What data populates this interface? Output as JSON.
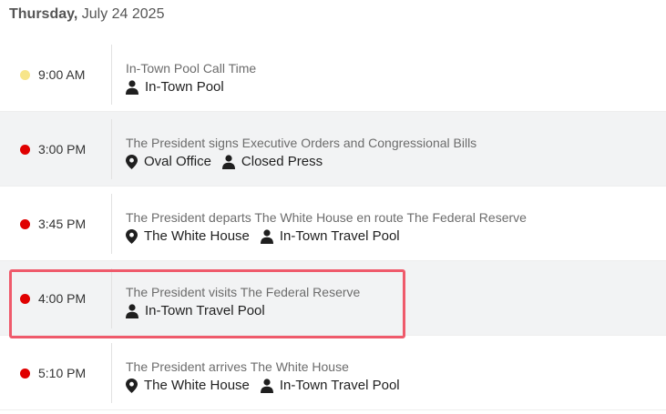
{
  "header": {
    "day": "Thursday,",
    "date": "July 24 2025"
  },
  "colors": {
    "tentative": "#f7e58a",
    "confirmed": "#e00000",
    "highlight": "#ef5a6b"
  },
  "events": [
    {
      "time": "9:00 AM",
      "status": "tentative",
      "title": "In-Town Pool Call Time",
      "location": "",
      "coverage": "In-Town Pool"
    },
    {
      "time": "3:00 PM",
      "status": "confirmed",
      "title": "The President signs Executive Orders and Congressional Bills",
      "location": "Oval Office",
      "coverage": "Closed Press"
    },
    {
      "time": "3:45 PM",
      "status": "confirmed",
      "title": "The President departs The White House en route The Federal Reserve",
      "location": "The White House",
      "coverage": "In-Town Travel Pool"
    },
    {
      "time": "4:00 PM",
      "status": "confirmed",
      "title": "The President visits The Federal Reserve",
      "location": "",
      "coverage": "In-Town Travel Pool"
    },
    {
      "time": "5:10 PM",
      "status": "confirmed",
      "title": "The President arrives The White House",
      "location": "The White House",
      "coverage": "In-Town Travel Pool"
    }
  ]
}
